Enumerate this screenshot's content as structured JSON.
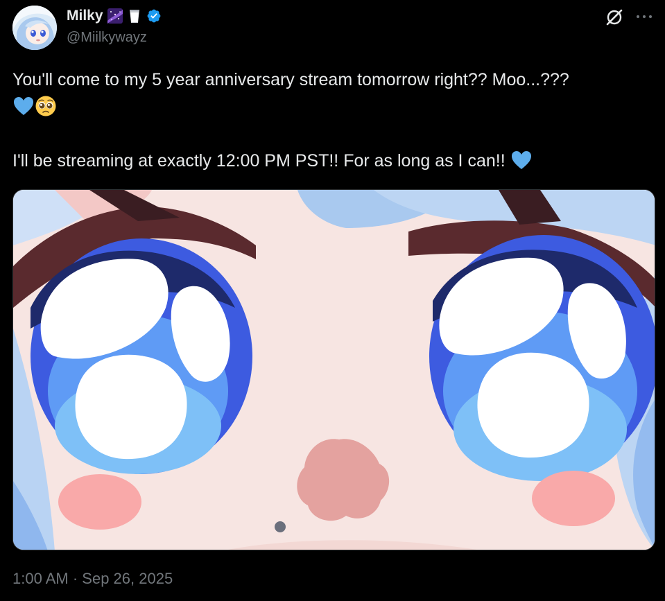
{
  "user": {
    "display_name": "Milky",
    "name_emojis": [
      "milky-way-emoji",
      "glass-of-milk-emoji"
    ],
    "verified": true,
    "handle": "@Miilkywayz"
  },
  "header_icons": [
    "grok-icon",
    "more-icon"
  ],
  "tweet": {
    "line1": "You'll come to my 5 year anniversary stream tomorrow right?? Moo...???",
    "line2_emojis": [
      "blue-heart-emoji",
      "pleading-face-emoji"
    ],
    "line3": "I'll be streaming at exactly 12:00 PM PST!! For as long as I can!!",
    "line3_emoji": "blue-heart-emoji"
  },
  "media": {
    "type": "image",
    "subject": "close-up anime character face with big blue eyes"
  },
  "meta": {
    "time": "1:00 AM",
    "separator": " · ",
    "date": "Sep 26, 2025"
  },
  "colors": {
    "background": "#000000",
    "text_primary": "#e7e9ea",
    "text_secondary": "#71767b",
    "verified_blue": "#1d9bf0",
    "heart_blue": "#5dadec"
  }
}
